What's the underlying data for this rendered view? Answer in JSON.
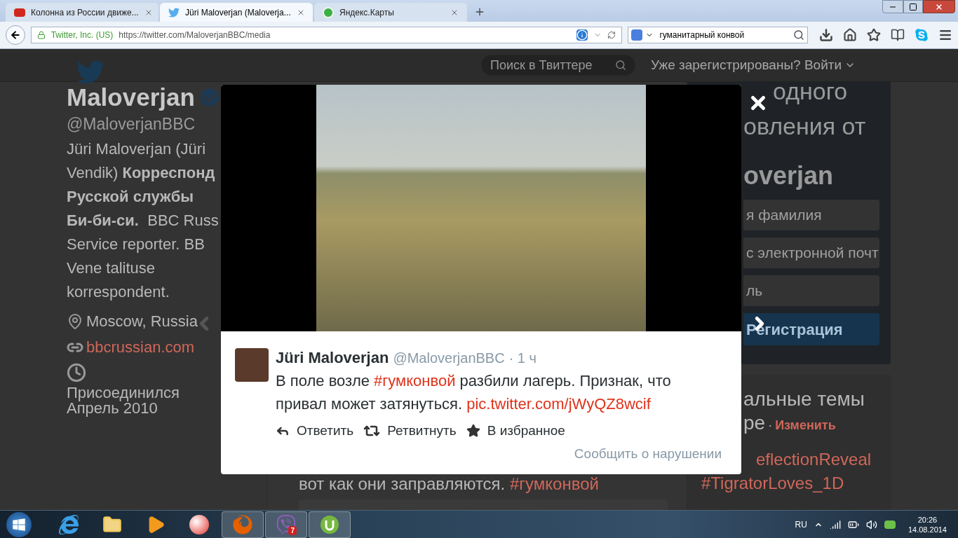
{
  "browser": {
    "tabs": [
      {
        "kind": "yap",
        "label": "Колонна из России движе...",
        "selected": false
      },
      {
        "kind": "twitter",
        "label": "Jüri Maloverjan (Maloverja...",
        "selected": true
      },
      {
        "kind": "yandex",
        "label": "Яндекс.Карты",
        "selected": false
      }
    ],
    "identity": "Twitter, Inc. (US)",
    "url": "https://twitter.com/MaloverjanBBC/media",
    "search_value": "гуманитарный конвой"
  },
  "header": {
    "search_placeholder": "Поиск в Твиттере",
    "login": "Уже зарегистрированы? Войти"
  },
  "profile": {
    "name": "Maloverjan",
    "handle": "@MaloverjanBBC",
    "bio_lines": [
      "Jüri Maloverjan (Jüri",
      "Vendik) **Корреспонд**",
      "**Русской службы**",
      "**Би-би-си.**  BBC Russ",
      "Service reporter. BB",
      "Vene talituse",
      "korrespondent."
    ],
    "location": "Moscow, Russia",
    "website": "bbcrussian.com",
    "joined": [
      "Присоединился",
      "Апрель 2010"
    ]
  },
  "timeline": {
    "segments": [
      {
        "kind": "text",
        "text": "вот как они заправляются. "
      },
      {
        "kind": "link",
        "text": "#гумконвой"
      }
    ]
  },
  "signup": {
    "heading_lines": [
      "одного",
      "овления от"
    ],
    "name": "overjan",
    "fields": [
      {
        "placeholder": "я фамилия"
      },
      {
        "placeholder": "с электронной почт"
      },
      {
        "placeholder": "ль"
      }
    ],
    "button": "Регистрация"
  },
  "trends": {
    "title_lines": [
      "альные темы",
      "ре"
    ],
    "separator": "·",
    "change": "Изменить",
    "items": [
      "eflectionReveal",
      "#TigratorLoves_1D"
    ]
  },
  "modal": {
    "author": "Jüri Maloverjan",
    "handle": "@MaloverjanBBC",
    "time": "· 1 ч",
    "segments": [
      {
        "kind": "text",
        "text": "В поле возле "
      },
      {
        "kind": "link",
        "text": "#гумконвой"
      },
      {
        "kind": "text",
        "text": " разбили лагерь. Признак, что привал может затянуться. "
      },
      {
        "kind": "link",
        "text": "pic.twitter.com/jWyQZ8wcif"
      }
    ],
    "actions": [
      {
        "kind": "reply",
        "label": "Ответить"
      },
      {
        "kind": "retweet",
        "label": "Ретвитнуть"
      },
      {
        "kind": "favorite",
        "label": "В избранное"
      }
    ],
    "report": "Сообщить о нарушении"
  },
  "taskbar": {
    "apps": [
      {
        "kind": "ie",
        "running": false
      },
      {
        "kind": "folder",
        "running": false
      },
      {
        "kind": "media",
        "running": false
      },
      {
        "kind": "photo",
        "running": false
      },
      {
        "kind": "firefox",
        "running": true
      },
      {
        "kind": "viber",
        "running": true,
        "badge": "7"
      },
      {
        "kind": "torrent",
        "running": true
      }
    ],
    "language": "RU",
    "time": "20:26",
    "date": "14.08.2014"
  }
}
